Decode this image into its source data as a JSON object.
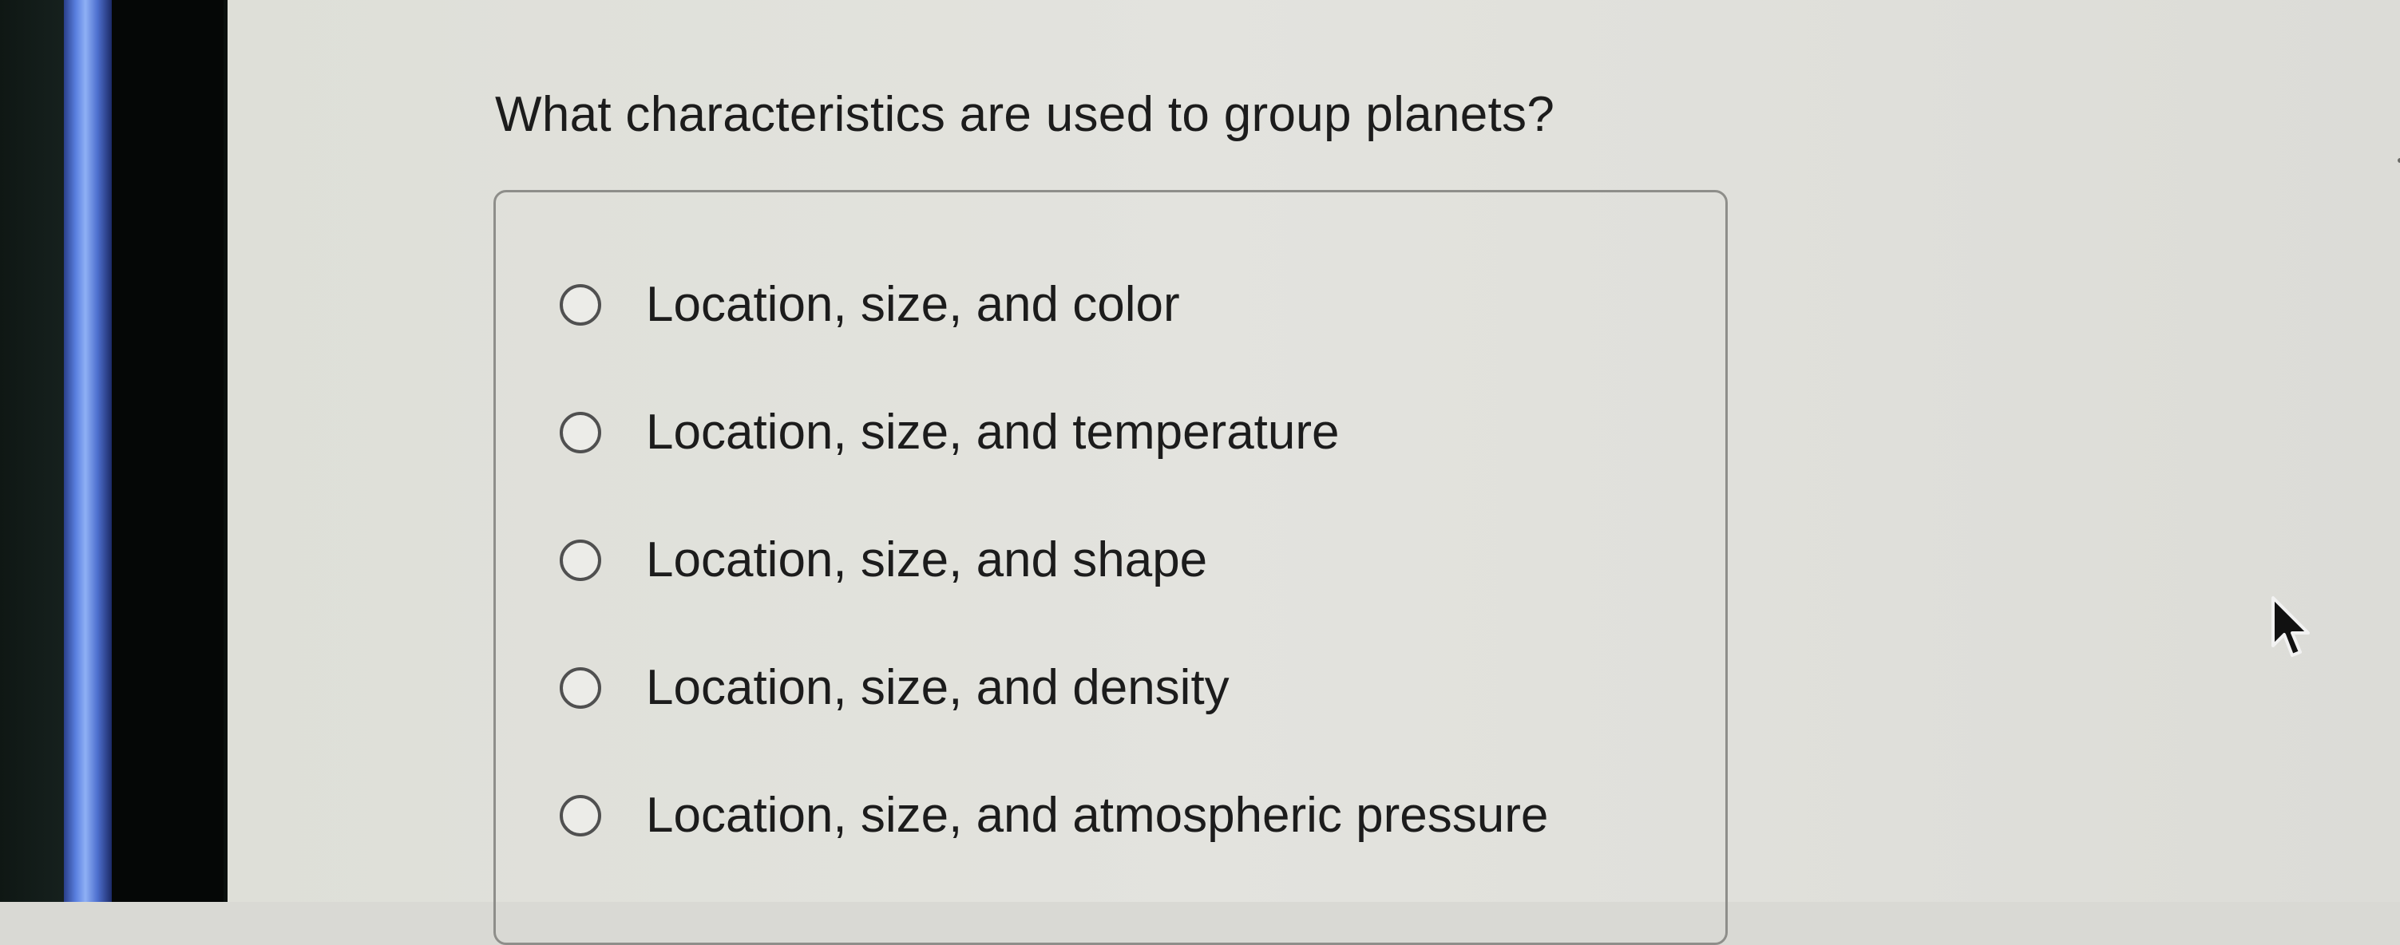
{
  "question": "What characteristics are used to group planets?",
  "options": [
    {
      "label": "Location, size, and color"
    },
    {
      "label": "Location, size, and temperature"
    },
    {
      "label": "Location, size, and shape"
    },
    {
      "label": "Location, size, and density"
    },
    {
      "label": "Location, size, and atmospheric pressure"
    }
  ],
  "icons": {
    "radio": "radio-unselected-icon",
    "cursor": "mouse-pointer-icon"
  }
}
